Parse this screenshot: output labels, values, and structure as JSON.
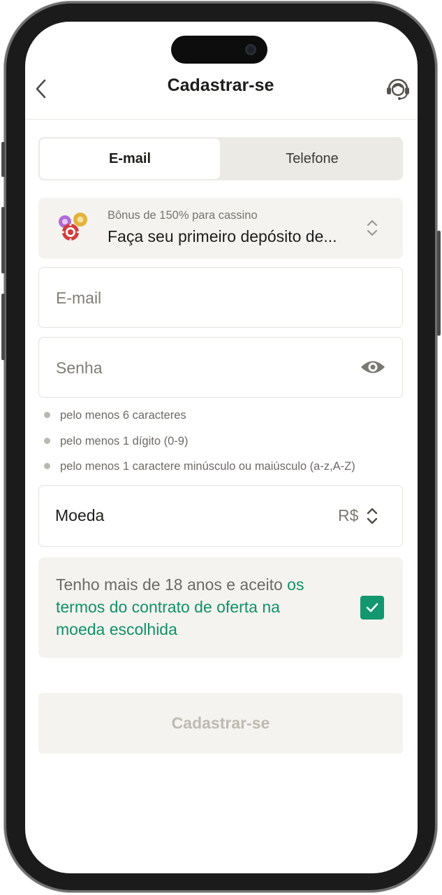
{
  "header": {
    "title": "Cadastrar-se",
    "back_icon": "chevron-left-icon",
    "support_icon": "headset-support-icon"
  },
  "tabs": [
    {
      "label": "E-mail",
      "active": true
    },
    {
      "label": "Telefone",
      "active": false
    }
  ],
  "bonus": {
    "subtitle": "Bônus de 150% para cassino",
    "title": "Faça seu primeiro depósito de...",
    "icon": "casino-chips-icon"
  },
  "form": {
    "email_placeholder": "E-mail",
    "password_placeholder": "Senha",
    "password_rules": [
      "pelo menos 6 caracteres",
      "pelo menos 1 dígito (0-9)",
      "pelo menos 1 caractere minúsculo ou maiúsculo (a-z,A-Z)"
    ],
    "currency_label": "Moeda",
    "currency_value": "R$"
  },
  "terms": {
    "text": "Tenho mais de 18 anos e aceito",
    "link_line1": "os",
    "link_line2": "termos do contrato de oferta na",
    "link_line3": "moeda escolhida",
    "checked": true
  },
  "submit_label": "Cadastrar-se",
  "colors": {
    "accent": "#12976e",
    "link": "#11906a",
    "background_panel": "#f4f3ef"
  }
}
